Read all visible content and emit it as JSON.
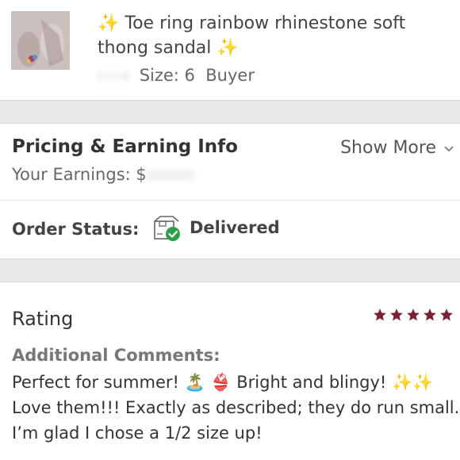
{
  "item": {
    "title": "✨ Toe ring rainbow rhinestone soft thong sandal ✨",
    "size_label": "Size: 6",
    "buyer_label": "Buyer",
    "thumbnail": "sandal-photo"
  },
  "pricing": {
    "title": "Pricing & Earning Info",
    "show_more": "Show More",
    "earnings_label": "Your Earnings: $"
  },
  "order": {
    "label": "Order Status:",
    "status": "Delivered",
    "status_icon": "package-delivered-icon",
    "status_color": "#2e9e49"
  },
  "rating": {
    "title": "Rating",
    "stars": 5,
    "star_color": "#7a2232",
    "comments_label": "Additional Comments:",
    "comments": "Perfect for summer! 🏝️ 👙 Bright and blingy! ✨✨ Love them!!! Exactly as described; they do run small. I’m glad I chose a 1/2 size up!"
  }
}
